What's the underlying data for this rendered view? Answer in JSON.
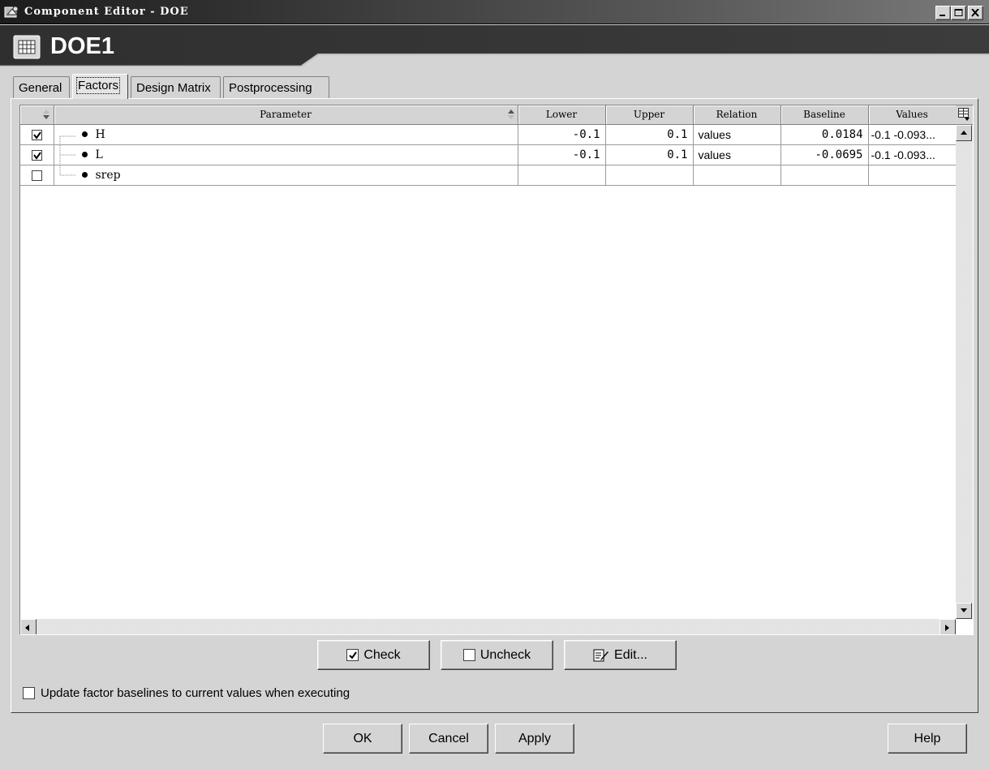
{
  "window": {
    "title": "Component Editor - DOE"
  },
  "header": {
    "component_name": "DOE1"
  },
  "tabs": [
    {
      "label": "General",
      "active": false
    },
    {
      "label": "Factors",
      "active": true
    },
    {
      "label": "Design Matrix",
      "active": false
    },
    {
      "label": "Postprocessing",
      "active": false
    }
  ],
  "grid": {
    "columns": [
      "Parameter",
      "Lower",
      "Upper",
      "Relation",
      "Baseline",
      "Values"
    ],
    "rows": [
      {
        "checked": true,
        "parameter": "H",
        "lower": "-0.1",
        "upper": "0.1",
        "relation": "values",
        "baseline": "0.0184",
        "values": "-0.1 -0.093..."
      },
      {
        "checked": true,
        "parameter": "L",
        "lower": "-0.1",
        "upper": "0.1",
        "relation": "values",
        "baseline": "-0.0695",
        "values": "-0.1 -0.093..."
      },
      {
        "checked": false,
        "parameter": "srep",
        "lower": "",
        "upper": "",
        "relation": "",
        "baseline": "",
        "values": ""
      }
    ]
  },
  "actions": {
    "check_label": "Check",
    "uncheck_label": "Uncheck",
    "edit_label": "Edit..."
  },
  "options": {
    "update_baselines_label": "Update factor baselines to current values when executing",
    "update_baselines_checked": false
  },
  "footer": {
    "ok_label": "OK",
    "cancel_label": "Cancel",
    "apply_label": "Apply",
    "help_label": "Help"
  }
}
